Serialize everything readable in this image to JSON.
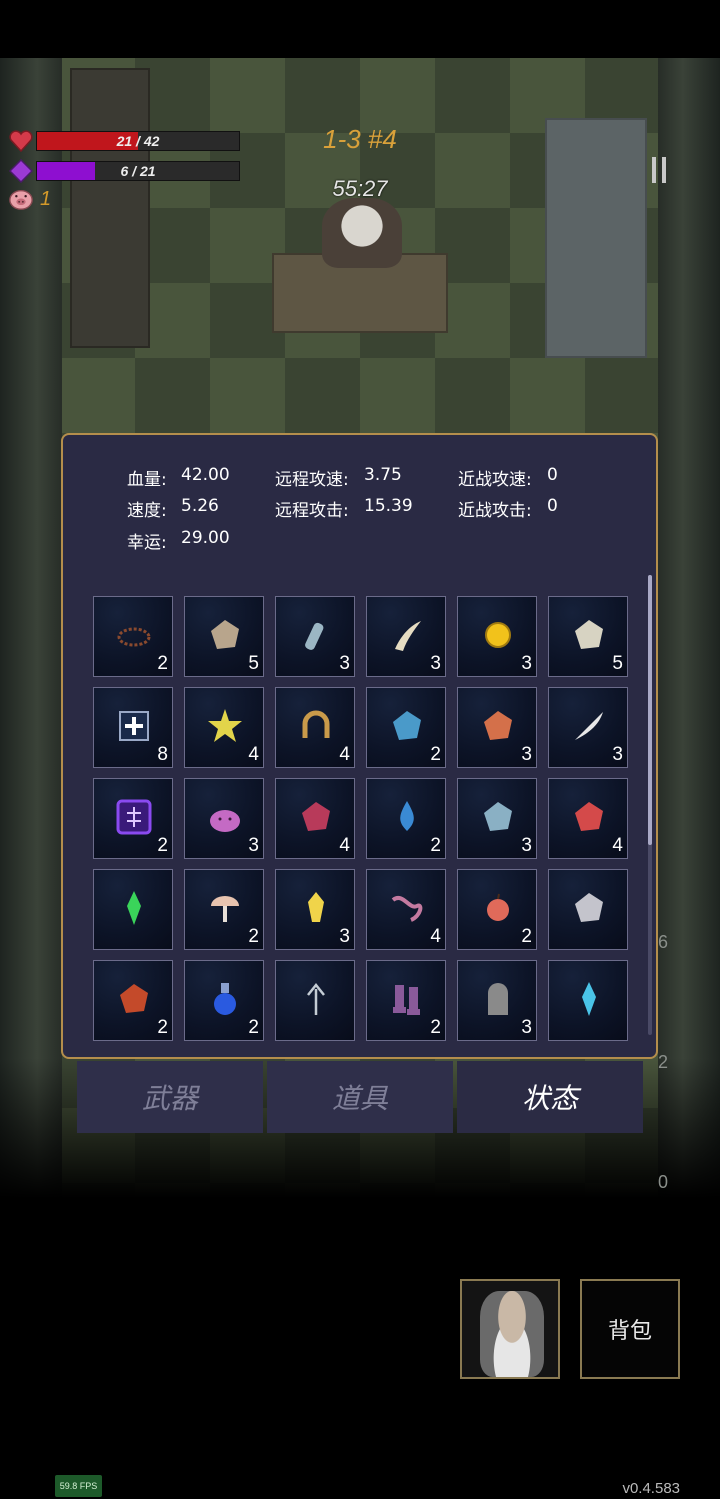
{
  "hud": {
    "hp_text": "21 / 42",
    "hp_fraction": 0.5,
    "mp_text": "6 / 21",
    "mp_fraction": 0.286,
    "coins": "1",
    "level": "1-3 #4",
    "timer": "55:27"
  },
  "side_numbers": [
    "6",
    "2",
    "0"
  ],
  "stats": {
    "hp_label": "血量:",
    "hp_value": "42.00",
    "speed_label": "速度:",
    "speed_value": "5.26",
    "luck_label": "幸运:",
    "luck_value": "29.00",
    "ranged_speed_label": "远程攻速:",
    "ranged_speed_value": "3.75",
    "ranged_attack_label": "远程攻击:",
    "ranged_attack_value": "15.39",
    "melee_speed_label": "近战攻速:",
    "melee_speed_value": "0",
    "melee_attack_label": "近战攻击:",
    "melee_attack_value": "0"
  },
  "items": [
    {
      "icon": "thorn-crown-icon",
      "count": "2",
      "color": "#8a4a2e"
    },
    {
      "icon": "bandage-icon",
      "count": "5",
      "color": "#b8a58c"
    },
    {
      "icon": "bottle-icon",
      "count": "3",
      "color": "#9bb6c4"
    },
    {
      "icon": "fang-icon",
      "count": "3",
      "color": "#e6dcc2"
    },
    {
      "icon": "gold-coin-icon",
      "count": "3",
      "color": "#f2c21b"
    },
    {
      "icon": "armor-piece-icon",
      "count": "5",
      "color": "#d7d3c2"
    },
    {
      "icon": "medkit-icon",
      "count": "8",
      "color": "#9aa9c7"
    },
    {
      "icon": "star-icon",
      "count": "4",
      "color": "#e2d44a"
    },
    {
      "icon": "horseshoe-icon",
      "count": "4",
      "color": "#c99a4a"
    },
    {
      "icon": "spellbook-icon",
      "count": "2",
      "color": "#4a9ac9"
    },
    {
      "icon": "feather-skull-icon",
      "count": "3",
      "color": "#d4704a"
    },
    {
      "icon": "feather-icon",
      "count": "3",
      "color": "#e8e8e8"
    },
    {
      "icon": "rune-icon",
      "count": "2",
      "color": "#8a4af0"
    },
    {
      "icon": "slime-icon",
      "count": "3",
      "color": "#c46ac4"
    },
    {
      "icon": "red-book-icon",
      "count": "4",
      "color": "#b83a5a"
    },
    {
      "icon": "water-drop-icon",
      "count": "2",
      "color": "#3a8ad4"
    },
    {
      "icon": "stone-icon",
      "count": "3",
      "color": "#8ab0c4"
    },
    {
      "icon": "flower-icon",
      "count": "4",
      "color": "#d44a4a"
    },
    {
      "icon": "green-crystal-icon",
      "count": "",
      "color": "#3ad45a"
    },
    {
      "icon": "mushroom-icon",
      "count": "2",
      "color": "#e8c4b0"
    },
    {
      "icon": "yellow-gem-icon",
      "count": "3",
      "color": "#f0d44a"
    },
    {
      "icon": "worm-icon",
      "count": "4",
      "color": "#c47aa0"
    },
    {
      "icon": "apple-icon",
      "count": "2",
      "color": "#e06a5a"
    },
    {
      "icon": "silver-ore-icon",
      "count": "",
      "color": "#c4c4cc"
    },
    {
      "icon": "fire-heart-icon",
      "count": "2",
      "color": "#c44a2a"
    },
    {
      "icon": "blue-potion-icon",
      "count": "2",
      "color": "#2a5ae0"
    },
    {
      "icon": "arrow-icon",
      "count": "",
      "color": "#c4ccd4"
    },
    {
      "icon": "boots-icon",
      "count": "2",
      "color": "#8a5a9a"
    },
    {
      "icon": "tombstone-icon",
      "count": "3",
      "color": "#8a8a8a"
    },
    {
      "icon": "blue-crystal-icon",
      "count": "",
      "color": "#4ac4e8"
    }
  ],
  "tabs": {
    "weapons": "武器",
    "props": "道具",
    "status": "状态"
  },
  "bag_label": "背包",
  "fps": "59.8 FPS",
  "version": "v0.4.583"
}
